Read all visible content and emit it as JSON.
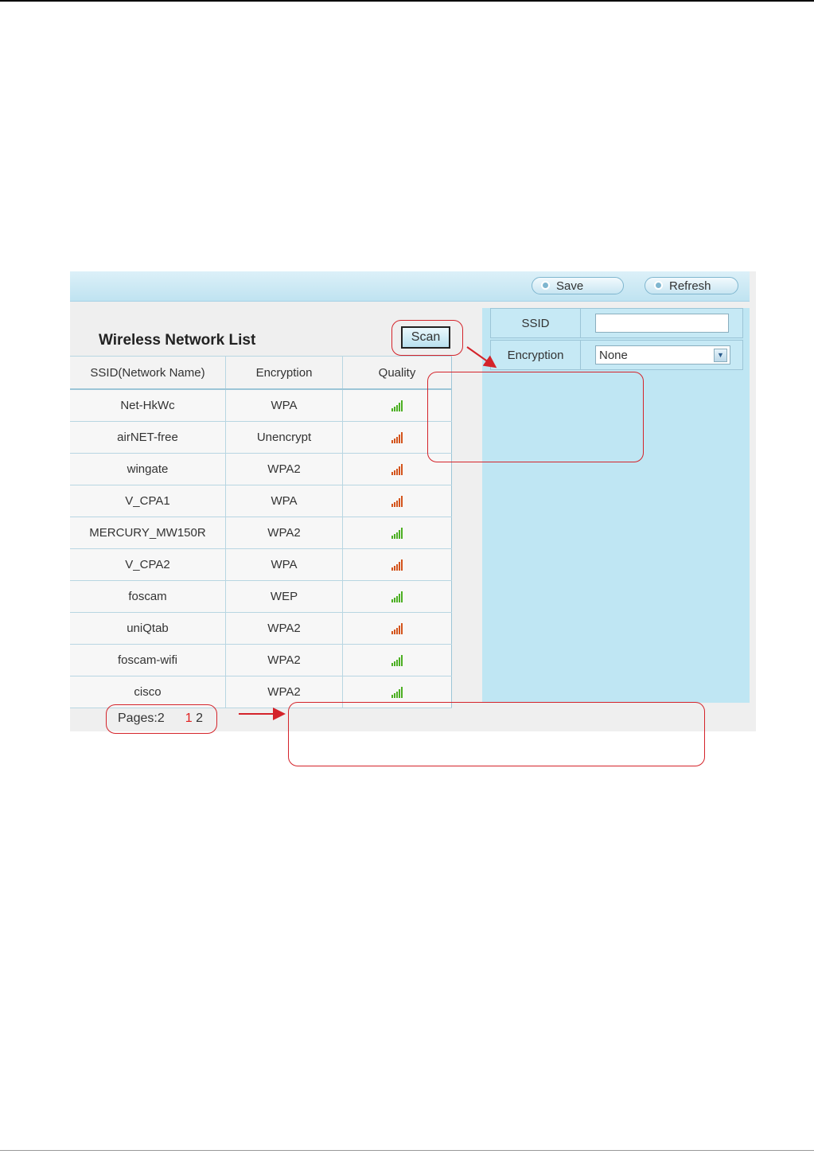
{
  "toolbar": {
    "save_label": "Save",
    "refresh_label": "Refresh"
  },
  "network_list": {
    "title": "Wireless Network List",
    "scan_label": "Scan",
    "columns": [
      "SSID(Network Name)",
      "Encryption",
      "Quality"
    ],
    "rows": [
      {
        "ssid": "Net-HkWc",
        "encryption": "WPA",
        "quality": "green"
      },
      {
        "ssid": "airNET-free",
        "encryption": "Unencrypt",
        "quality": "orange"
      },
      {
        "ssid": "wingate",
        "encryption": "WPA2",
        "quality": "orange"
      },
      {
        "ssid": "V_CPA1",
        "encryption": "WPA",
        "quality": "orange"
      },
      {
        "ssid": "MERCURY_MW150R",
        "encryption": "WPA2",
        "quality": "green"
      },
      {
        "ssid": "V_CPA2",
        "encryption": "WPA",
        "quality": "orange"
      },
      {
        "ssid": "foscam",
        "encryption": "WEP",
        "quality": "green"
      },
      {
        "ssid": "uniQtab",
        "encryption": "WPA2",
        "quality": "orange"
      },
      {
        "ssid": "foscam-wifi",
        "encryption": "WPA2",
        "quality": "green"
      },
      {
        "ssid": "cisco",
        "encryption": "WPA2",
        "quality": "green"
      }
    ],
    "pages_label": "Pages:2",
    "page_current": "1",
    "page_other": "2"
  },
  "form": {
    "ssid_label": "SSID",
    "ssid_value": "",
    "encryption_label": "Encryption",
    "encryption_value": "None"
  },
  "colors": {
    "signal_green": "#4caf22",
    "signal_orange": "#d4541c",
    "callout_red": "#d4232a",
    "panel_blue": "#bfe6f3"
  },
  "icons": {
    "signal": "signal-strength-icon",
    "dropdown": "chevron-down-icon",
    "button_dot": "circle-icon"
  }
}
